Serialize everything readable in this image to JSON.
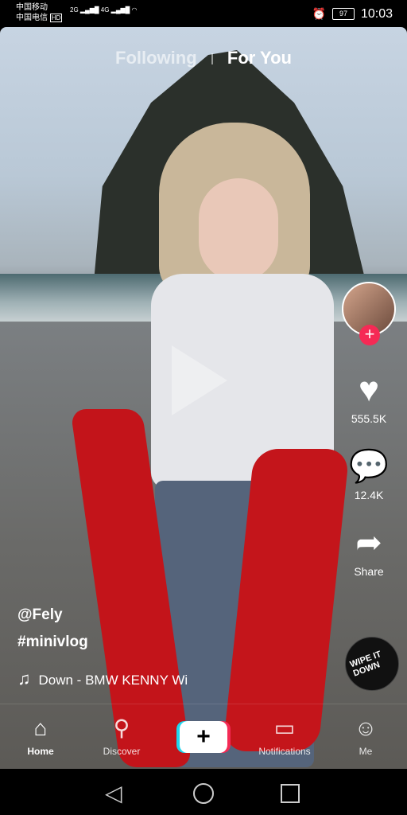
{
  "status": {
    "carrier1": "中国移动",
    "carrier2": "中国电信",
    "hd": "HD",
    "net1": "2G",
    "net2": "4G",
    "battery": "97",
    "time": "10:03"
  },
  "tabs": {
    "following": "Following",
    "for_you": "For You"
  },
  "actions": {
    "likes": "555.5K",
    "comments": "12.4K",
    "share": "Share"
  },
  "caption": {
    "username": "@Fely",
    "hashtag": "#minivlog",
    "music": "Down - BMW KENNY    Wi"
  },
  "disc": {
    "text": "WIPE IT DOWN"
  },
  "nav": {
    "home": "Home",
    "discover": "Discover",
    "notifications": "Notifications",
    "me": "Me"
  },
  "icons": {
    "heart": "heart-icon",
    "comment": "comment-icon",
    "share": "share-icon",
    "music": "music-note-icon"
  },
  "colors": {
    "accent_red": "#f52a55",
    "accent_cyan": "#20d5ec"
  }
}
